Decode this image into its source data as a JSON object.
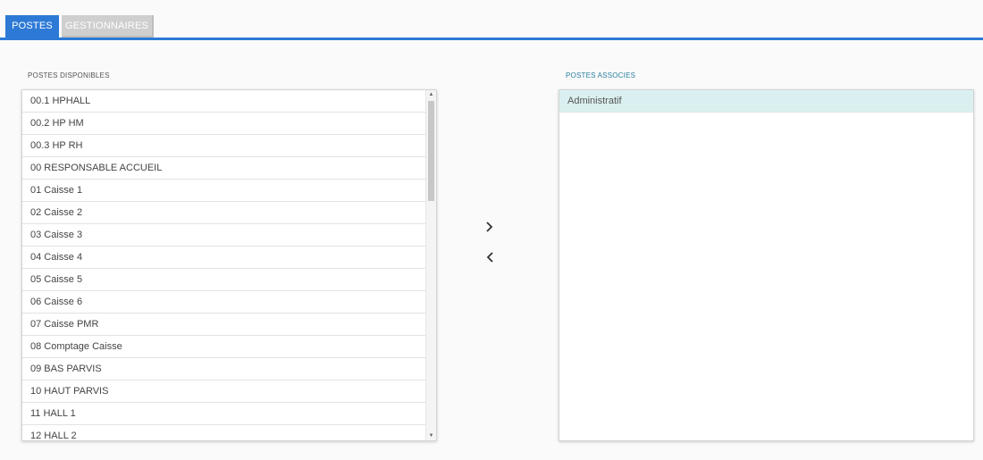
{
  "tabs": [
    {
      "label": "POSTES",
      "active": true
    },
    {
      "label": "GESTIONNAIRES",
      "active": false
    }
  ],
  "colors": {
    "accent": "#2d7ad6",
    "selected_row": "#daf0f0",
    "associated_label": "#2a7fa0"
  },
  "available": {
    "label": "POSTES DISPONIBLES",
    "items": [
      "00.1 HPHALL",
      "00.2 HP HM",
      "00.3 HP RH",
      "00 RESPONSABLE ACCUEIL",
      "01 Caisse 1",
      "02 Caisse 2",
      "03 Caisse 3",
      "04 Caisse 4",
      "05 Caisse 5",
      "06 Caisse 6",
      "07 Caisse PMR",
      "08 Comptage Caisse",
      "09 BAS PARVIS",
      "10 HAUT PARVIS",
      "11 HALL 1",
      "12 HALL 2"
    ]
  },
  "associated": {
    "label": "POSTES ASSOCIES",
    "items": [
      "Administratif"
    ]
  },
  "icons": {
    "move_right": "chevron-right-icon",
    "move_left": "chevron-left-icon",
    "scroll_up": "triangle-up-icon",
    "scroll_down": "triangle-down-icon"
  }
}
